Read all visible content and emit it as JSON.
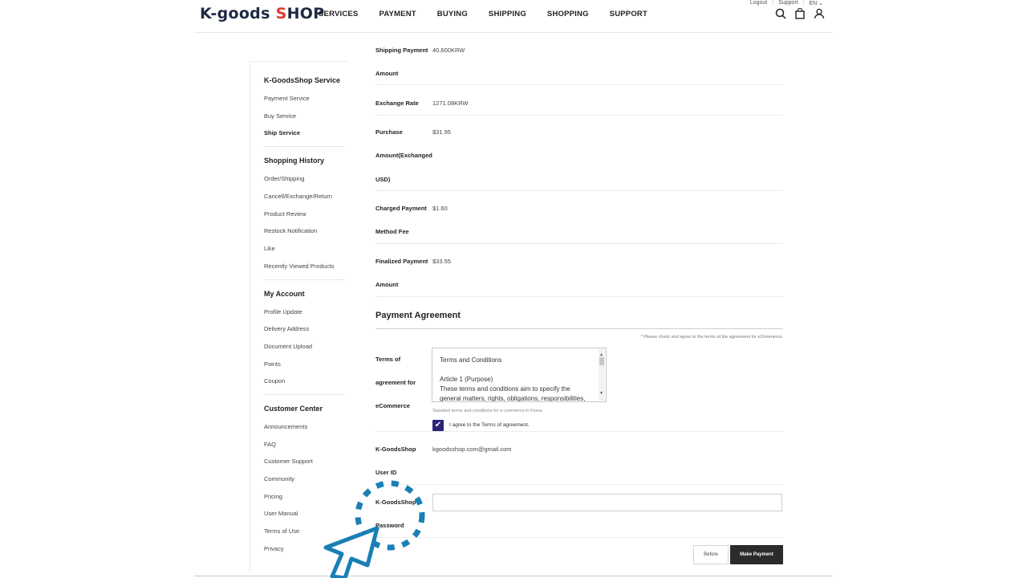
{
  "header": {
    "logo_part1": "K-",
    "logo_part2": "goods ",
    "logo_s": "S",
    "logo_hop": "HOP",
    "nav": [
      "SERVICES",
      "PAYMENT",
      "BUYING",
      "SHIPPING",
      "SHOPPING",
      "SUPPORT"
    ],
    "util": {
      "logout": "Logout",
      "support": "Support",
      "lang": "EN"
    },
    "icons": [
      "search-icon",
      "bag-icon",
      "user-icon"
    ]
  },
  "sidebar": {
    "sections": [
      {
        "title": "K-GoodsShop Service",
        "items": [
          "Payment Service",
          "Buy Service",
          "Ship Service"
        ],
        "active": "Ship Service"
      },
      {
        "title": "Shopping History",
        "items": [
          "Order/Shipping",
          "Cancell/Exchange/Return",
          "Product Review",
          "Restock Notification",
          "Like",
          "Recently Viewed Products"
        ]
      },
      {
        "title": "My Account",
        "items": [
          "Profile Update",
          "Delivery Address",
          "Document Upload",
          "Points",
          "Coupon"
        ]
      },
      {
        "title": "Customer Center",
        "items": [
          "Announcements",
          "FAQ",
          "Customer Support",
          "Community",
          "Pricing",
          "User Manual",
          "Terms of Use",
          "Privacy"
        ]
      }
    ]
  },
  "payment_rows": [
    {
      "label_lines": [
        "Shipping Payment",
        "Amount"
      ],
      "value": "40,600KRW"
    },
    {
      "label_lines": [
        "Exchange Rate"
      ],
      "value": "1271.08KRW"
    },
    {
      "label_lines": [
        "Purchase",
        "Amount(Exchanged",
        "USD)"
      ],
      "value": "$31.95"
    },
    {
      "label_lines": [
        "Charged Payment",
        "Method Fee"
      ],
      "value": "$1.60"
    },
    {
      "label_lines": [
        "Finalized Payment",
        "Amount"
      ],
      "value": "$33.55"
    }
  ],
  "agreement": {
    "title": "Payment Agreement",
    "note_star": "*",
    "note": " Please check and agree to the terms of the agreement for eCommerce.",
    "terms_label_lines": [
      "Terms of",
      "agreement for",
      "eCommerce"
    ],
    "terms_text": [
      "Terms and Conditions",
      "",
      "Article 1 (Purpose)",
      "These terms and conditions aim to specify the",
      "general matters, rights, obligations, responsibilities,"
    ],
    "standard_note": "Standard terms and conditions for e-commerce in Korea",
    "agree_label": "I agree to the Terms of agreement.",
    "agree_checked": true,
    "user_id_label_lines": [
      "K-GoodsShop",
      "User ID"
    ],
    "user_id_value": "kgoodsshop.com@gmail.com",
    "password_label_lines": [
      "K-GoodsShop",
      "Password"
    ],
    "password_value": ""
  },
  "buttons": {
    "before": "Before",
    "make_payment": "Make Payment"
  },
  "colors": {
    "brand_dark": "#1f2a44",
    "brand_red": "#e23b2a",
    "checkbox": "#2a237a",
    "pay_button": "#2b2b2b",
    "cursor": "#1a7fb5"
  }
}
